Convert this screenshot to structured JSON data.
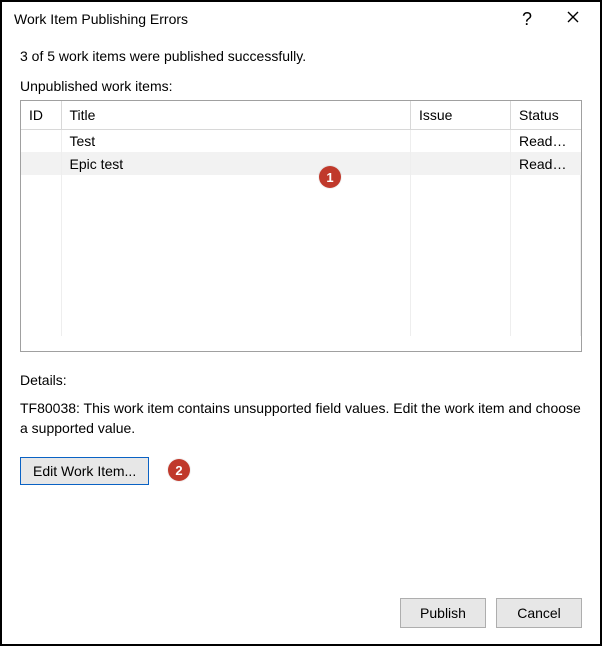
{
  "titlebar": {
    "title": "Work Item Publishing Errors",
    "help_label": "?",
    "close_label": "Close"
  },
  "summary": "3 of 5 work items were published successfully.",
  "unpublished_label": "Unpublished work items:",
  "columns": {
    "id": "ID",
    "title": "Title",
    "issue": "Issue",
    "status": "Status"
  },
  "rows": [
    {
      "id": "",
      "title": "Test",
      "issue": "",
      "status": "Ready ...",
      "selected": false
    },
    {
      "id": "",
      "title": "Epic test",
      "issue": "",
      "status": "Ready ...",
      "selected": true
    }
  ],
  "details_label": "Details:",
  "details_text": "TF80038: This work item contains unsupported field values. Edit the work item and choose a supported value.",
  "edit_button_label": "Edit Work Item...",
  "footer": {
    "publish": "Publish",
    "cancel": "Cancel"
  },
  "callouts": {
    "one": "1",
    "two": "2"
  }
}
